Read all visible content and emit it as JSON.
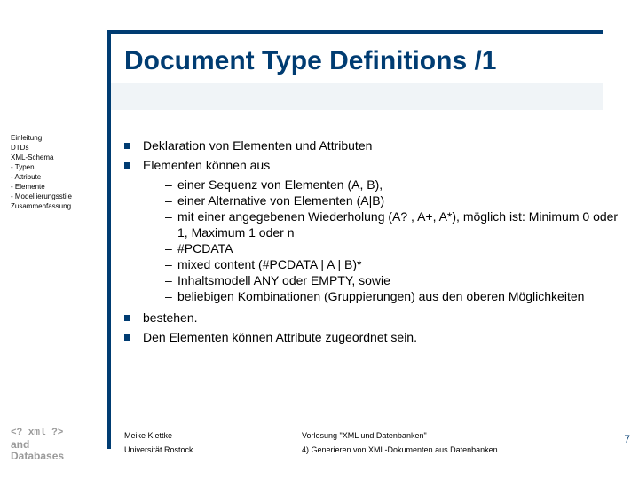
{
  "title": "Document Type Definitions /1",
  "sidebar": [
    "Einleitung",
    "DTDs",
    "XML-Schema",
    "- Typen",
    "- Attribute",
    "- Elemente",
    "- Modellierungsstile",
    "Zusammenfassung"
  ],
  "bullets_top": [
    "Deklaration von Elementen und Attributen",
    "Elementen können aus"
  ],
  "sub_bullets": [
    "einer Sequenz von Elementen (A, B),",
    "einer Alternative von Elementen (A|B)",
    "mit einer angegebenen Wiederholung (A? , A+, A*), möglich ist: Minimum 0 oder 1, Maximum 1 oder n",
    "#PCDATA",
    "mixed content (#PCDATA | A | B)*",
    "Inhaltsmodell ANY oder EMPTY, sowie",
    "beliebigen Kombinationen (Gruppierungen) aus den oberen Möglichkeiten"
  ],
  "bullets_bottom": [
    "bestehen.",
    "Den Elementen können Attribute zugeordnet sein."
  ],
  "logo": {
    "line1": "<? xml ?>",
    "line2": "and",
    "line3": "Databases"
  },
  "footer": {
    "author": "Meike Klettke",
    "lecture": "Vorlesung \"XML und Datenbanken\"",
    "uni": "Universität Rostock",
    "chapter": "4) Generieren von XML-Dokumenten aus Datenbanken"
  },
  "page": "7"
}
